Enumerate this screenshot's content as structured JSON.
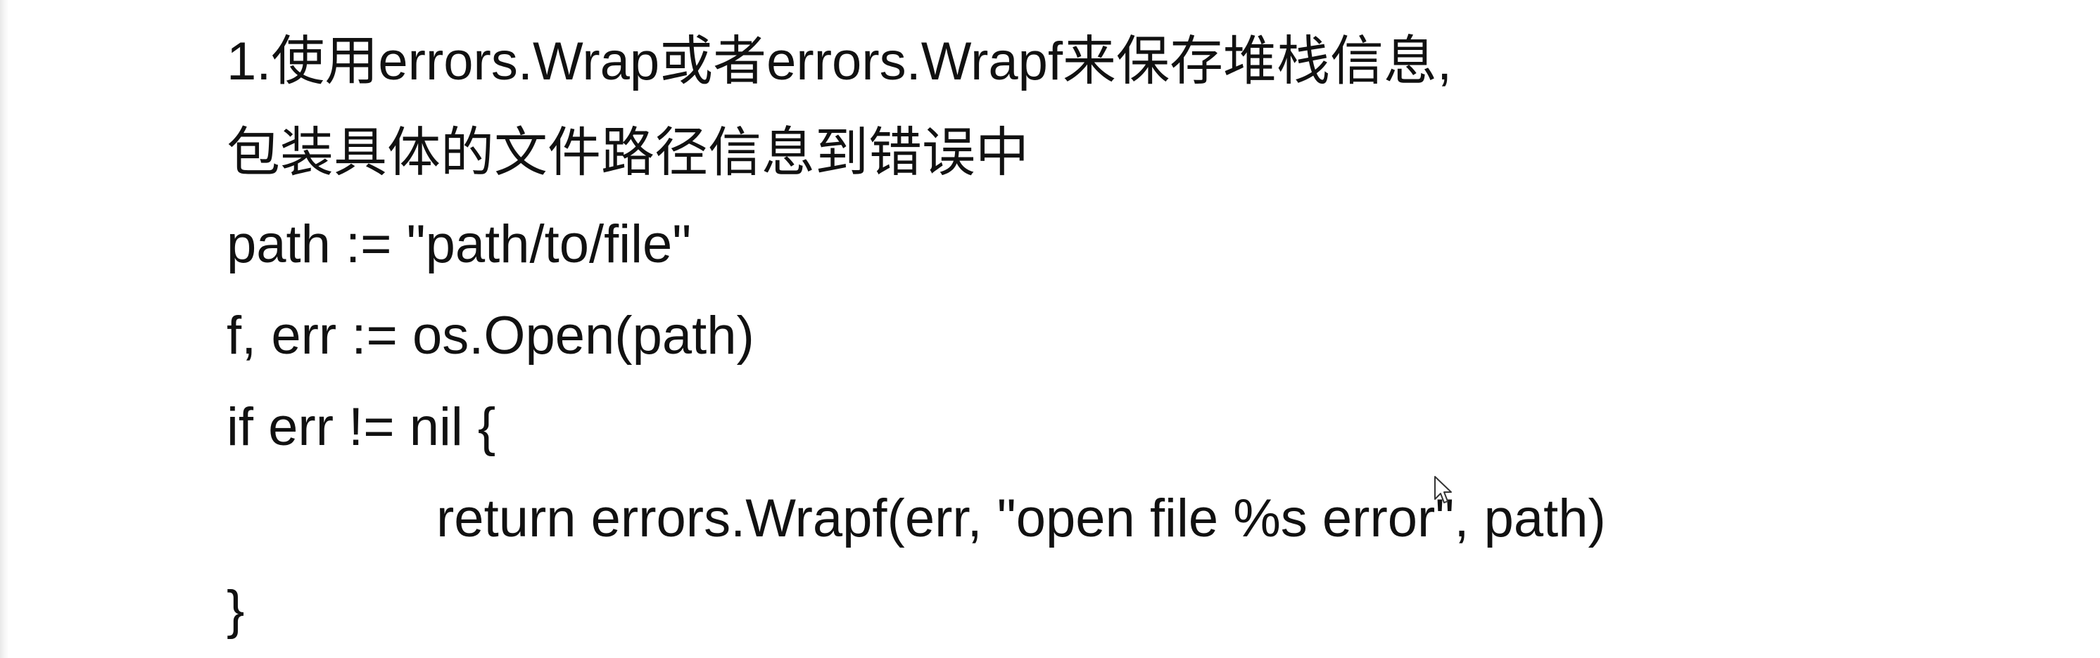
{
  "document": {
    "lines": [
      "1.使用errors.Wrap或者errors.Wrapf来保存堆栈信息,",
      "包装具体的文件路径信息到错误中",
      "path := \"path/to/file\"",
      "f, err := os.Open(path)",
      "if err != nil {",
      "return errors.Wrapf(err, \"open file %s error\", path)",
      "}"
    ]
  },
  "cursor": {
    "icon": "mouse-pointer-icon"
  }
}
